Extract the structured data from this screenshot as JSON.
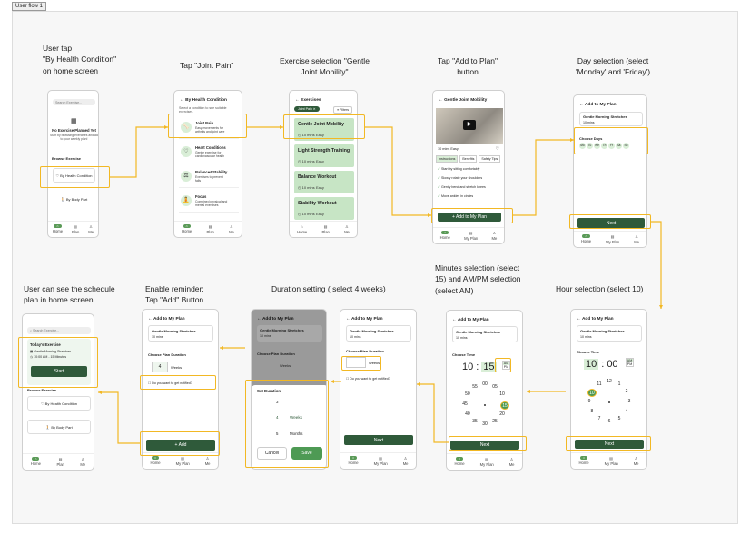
{
  "frame_label": "User flow 1",
  "captions": {
    "c1": "User tap\n\"By Health Condition\"\non home screen",
    "c2": "Tap \"Joint Pain\"",
    "c3": "Exercise selection \"Gentle\nJoint Mobility\"",
    "c4": "Tap \"Add to Plan\"\nbutton",
    "c5": "Day selection (select\n'Monday' and 'Friday')",
    "c6": "Hour selection (select 10)",
    "c7": "Minutes selection (select\n15) and AM/PM selection\n(select AM)",
    "c8": "Duration setting ( select 4 weeks)",
    "c9": "Enable reminder;\nTap \"Add\" Button",
    "c10": "User can see the schedule\nplan in home screen"
  },
  "nav": {
    "home": "Home",
    "plan": "Plan",
    "me": "Me",
    "my_plan": "My Plan"
  },
  "s1": {
    "search": "Search Exercise...",
    "empty_title": "No Exercise Planned Yet",
    "empty_sub": "Start by browsing exercises and add\nto your weekly plan!",
    "browse": "Browse Exercise",
    "by_health": "By Health Condition",
    "by_body": "By Body Part"
  },
  "s2": {
    "title": "By Health Condition",
    "sub": "Select a condition to see suitable\nexercises.",
    "items": [
      {
        "t": "Joint Pain",
        "d": "Easy movements for\narthritis and joint care"
      },
      {
        "t": "Heart Conditions",
        "d": "Gentle exercise for\ncardiovascular health"
      },
      {
        "t": "Balance&Stability",
        "d": "Exercises to prevent\nfalls"
      },
      {
        "t": "Focus",
        "d": "Combined physical and\nmental exercises"
      }
    ]
  },
  "s3": {
    "title": "Exercises",
    "chip": "Joint Pain ✕",
    "filters": "Filters",
    "items": [
      {
        "t": "Gentle Joint Mobility",
        "m": "10 mins",
        "l": "Easy"
      },
      {
        "t": "Light Strength Training",
        "m": "10 mins",
        "l": "Easy"
      },
      {
        "t": "Balance Workout",
        "m": "10 mins",
        "l": "Easy"
      },
      {
        "t": "Stability Workout",
        "m": "10 mins",
        "l": "Easy"
      }
    ]
  },
  "s4": {
    "title": "Gentle Joint Mobility",
    "meta": "10 mins   Easy",
    "tabs": [
      "Instructions",
      "Benefits",
      "Safety Tips"
    ],
    "steps": [
      "Start by sitting comfortably",
      "Slowly rotate your shoulders",
      "Gently bend and stretch knees",
      "Move ankles in circles"
    ],
    "add": "+ Add to My Plan"
  },
  "s5": {
    "title": "Add to My Plan",
    "ex": "Gentle Morning Stretches",
    "mins": "10 mins",
    "choose_days": "Choose Days",
    "days": [
      "Mo",
      "Tu",
      "We",
      "Th",
      "Fr",
      "Sa",
      "Su"
    ],
    "next": "Next"
  },
  "s6": {
    "title": "Add to My Plan",
    "ex": "Gentle Morning Stretches",
    "mins": "10 mins",
    "choose_time": "Choose Time",
    "hh": "10",
    "mm": "00",
    "am": "AM",
    "pm": "PM",
    "next": "Next"
  },
  "s7": {
    "title": "Add to My Plan",
    "ex": "Gentle Morning Stretches",
    "mins": "10 mins",
    "choose_time": "Choose Time",
    "hh": "10",
    "mm": "15",
    "am": "AM",
    "pm": "PM",
    "next": "Next"
  },
  "s8": {
    "title": "Add to My Plan",
    "ex": "Gentle Morning Stretches",
    "mins": "10 mins",
    "dur": "Choose Plan Duration",
    "weeks": "Weeks",
    "notify": "Do you want to get notified?",
    "next": "Next"
  },
  "s9": {
    "title": "Add to My Plan",
    "ex": "Gentle Morning Stretches",
    "mins": "10 mins",
    "dur": "Choose Plan Duration",
    "weeks": "Weeks",
    "set": "Set Duration",
    "opts": [
      "3",
      "4",
      "5"
    ],
    "opt_w": "Weeks",
    "opt_m": "Months",
    "cancel": "Cancel",
    "save": "Save"
  },
  "s10": {
    "title": "Add to My Plan",
    "ex": "Gentle Morning Stretches",
    "mins": "10 mins",
    "dur": "Choose Plan Duration",
    "val": "4",
    "weeks": "Weeks",
    "notify": "Do you want to get notified?",
    "add": "+ Add"
  },
  "s11": {
    "search": "Search Exercise...",
    "today": "Today's Exercise",
    "ex": "Gentle Morning Stretches",
    "time": "10:00 AM - 15 Minutes",
    "start": "Start",
    "browse": "Browse Exercise",
    "by_health": "By Health Condition",
    "by_body": "By Body Part"
  },
  "clock_h": [
    "12",
    "1",
    "2",
    "3",
    "4",
    "5",
    "6",
    "7",
    "8",
    "9",
    "10",
    "11"
  ],
  "clock_m": [
    "00",
    "05",
    "10",
    "15",
    "20",
    "25",
    "30",
    "35",
    "40",
    "45",
    "50",
    "55"
  ],
  "colors": {
    "accent": "#2f5a3a",
    "highlight": "#f2b824",
    "card": "#c7e5c5"
  }
}
